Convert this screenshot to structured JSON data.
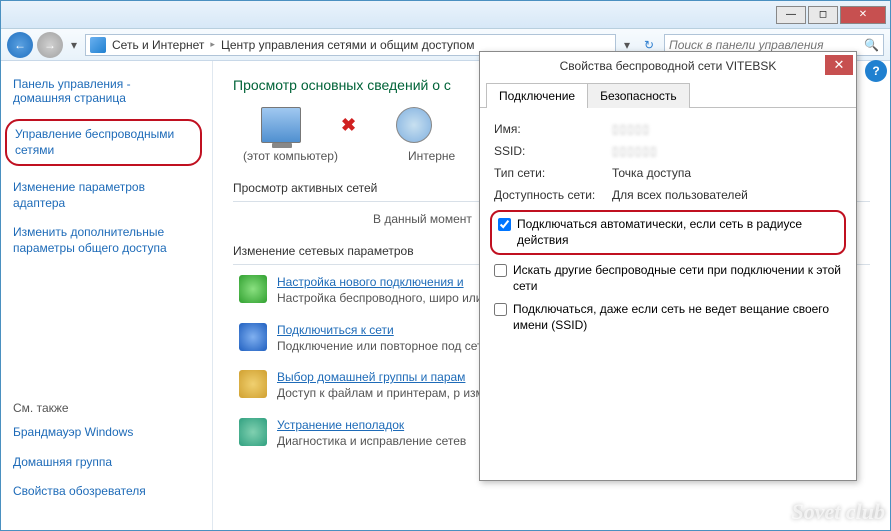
{
  "window": {
    "min": "—",
    "max": "◻",
    "close": "✕"
  },
  "nav": {
    "back": "←",
    "fwd": "→",
    "dd": "▾",
    "refresh": "↻"
  },
  "breadcrumb": {
    "seg1": "Сеть и Интернет",
    "seg2": "Центр управления сетями и общим доступом",
    "sep": "▸"
  },
  "search": {
    "placeholder": "Поиск в панели управления"
  },
  "sidebar": {
    "home1": "Панель управления -",
    "home2": "домашняя страница",
    "links": {
      "wireless": "Управление беспроводными сетями",
      "adapter": "Изменение параметров адаптера",
      "sharing1": "Изменить дополнительные",
      "sharing2": "параметры общего доступа"
    },
    "see_also": "См. также",
    "bottom": {
      "firewall": "Брандмауэр Windows",
      "homegroup": "Домашняя группа",
      "ie": "Свойства обозревателя"
    }
  },
  "main": {
    "title": "Просмотр основных сведений о с",
    "this_pc": "(этот компьютер)",
    "internet": "Интерне",
    "active_header": "Просмотр активных сетей",
    "active_sub": "В данный момент",
    "change_header": "Изменение сетевых параметров",
    "tasks": {
      "t1": {
        "link": "Настройка нового подключения и",
        "desc": "Настройка беспроводного, широ\nили же настройка маршрутизато"
      },
      "t2": {
        "link": "Подключиться к сети",
        "desc": "Подключение или повторное под\nсетевому соединению или подкл"
      },
      "t3": {
        "link": "Выбор домашней группы и парам",
        "desc": "Доступ к файлам и принтерам, р\nизменение параметров общего д"
      },
      "t4": {
        "link": "Устранение неполадок",
        "desc": "Диагностика и исправление сетев"
      }
    }
  },
  "dialog": {
    "title": "Свойства беспроводной сети VITEBSK",
    "close": "✕",
    "tabs": {
      "connect": "Подключение",
      "security": "Безопасность"
    },
    "props": {
      "name_l": "Имя:",
      "name_v": "▯▯▯▯▯",
      "ssid_l": "SSID:",
      "ssid_v": "▯▯▯▯▯▯",
      "type_l": "Тип сети:",
      "type_v": "Точка доступа",
      "avail_l": "Доступность сети:",
      "avail_v": "Для всех пользователей"
    },
    "checks": {
      "auto": "Подключаться автоматически, если сеть в радиусе действия",
      "other": "Искать другие беспроводные сети при подключении к этой сети",
      "hidden": "Подключаться, даже если сеть не ведет вещание своего имени (SSID)"
    },
    "check_state": {
      "auto": true,
      "other": false,
      "hidden": false
    }
  },
  "help": "?",
  "watermark": "Sovet club"
}
